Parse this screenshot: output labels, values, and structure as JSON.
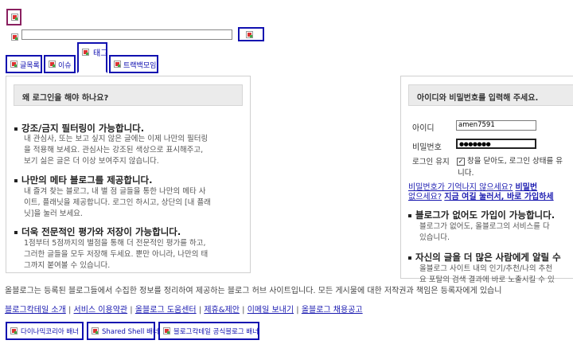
{
  "header": {
    "search_value": "",
    "tabs": [
      {
        "label": "글목록"
      },
      {
        "label": "이슈"
      },
      {
        "label": "태그"
      },
      {
        "label": "트랙백모임"
      }
    ]
  },
  "why_login": {
    "heading": "왜 로그인을 해야 하나요?",
    "features": [
      {
        "title": "강조/금지 필터링이 가능합니다.",
        "desc": [
          "내 관심사, 또는 보고 싶지 않은 글에는 이제 나만의 필터링",
          "을 적용해 보세요. 관심사는 강조된 색상으로 표시해주고,",
          "보기 싫은 글은 더 이상 보여주지 않습니다."
        ]
      },
      {
        "title": "나만의 메타 블로그를 제공합니다.",
        "desc": [
          "내 즐겨 찾는 블로그, 내 별 점 글들을 통한 나만의 메타 사",
          "이트, 플래닛을 제공합니다. 로그인 하시고, 상단의 [내 플래",
          "닛]을 눌러 보세요."
        ]
      },
      {
        "title": "더욱 전문적인 평가와 저장이 가능합니다.",
        "desc": [
          "1점부터 5점까지의 별점을 통해 더 전문적인 평가를 하고,",
          "그러한 글들을 모두 저장해 두세요. 뿐만 아니라, 나만의 태",
          "그까지 붙여볼 수 있습니다."
        ]
      }
    ]
  },
  "login": {
    "heading": "아이디와 비밀번호를 입력해 주세요.",
    "id_label": "아이디",
    "id_value": "amen7591",
    "pw_label": "비밀번호",
    "pw_value": "●●●●●●●",
    "keep_label": "로그인 유지",
    "keep_desc_1": "창을 닫아도, 로그인 상태를 유",
    "keep_desc_2": "니다.",
    "forgot_1": "비밀번호가 기억나지 않으세요?",
    "forgot_2": "비밀번",
    "noacc_1": "없으세요?",
    "noacc_2": "지금 여길 눌러서, 바로 가입하세",
    "feature1_title": "블로그가 없어도 가입이 가능합니다.",
    "feature1_desc": [
      "블로그가 없어도, 올블로그의 서비스를 다",
      "있습니다."
    ],
    "feature2_title": "자신의 글을 더 많은 사람에게 알릴 수",
    "feature2_desc": [
      "올블로그 사이트 내의 인기/추천/나의 추천",
      "요 포탈의 검색 결과에 바로 노출시킬 수 있"
    ]
  },
  "footer": {
    "notice": "올블로그는 등록된 블로그들에서 수집한 정보를 정리하여 제공하는 블로그 허브 사이트입니다. 모든 게시물에 대한 저작권과 책임은 등록자에게 있습니",
    "links": [
      "블로그칵테일 소개",
      "서비스 이용약관",
      "올블로그 도움센터",
      "제휴&제안",
      "이메일 보내기",
      "올블로그 채용공고"
    ],
    "banners": [
      "다이나믹코리아 배너",
      "Shared Shell 배너",
      "블로그칵테일 공식블로그 배너"
    ]
  }
}
